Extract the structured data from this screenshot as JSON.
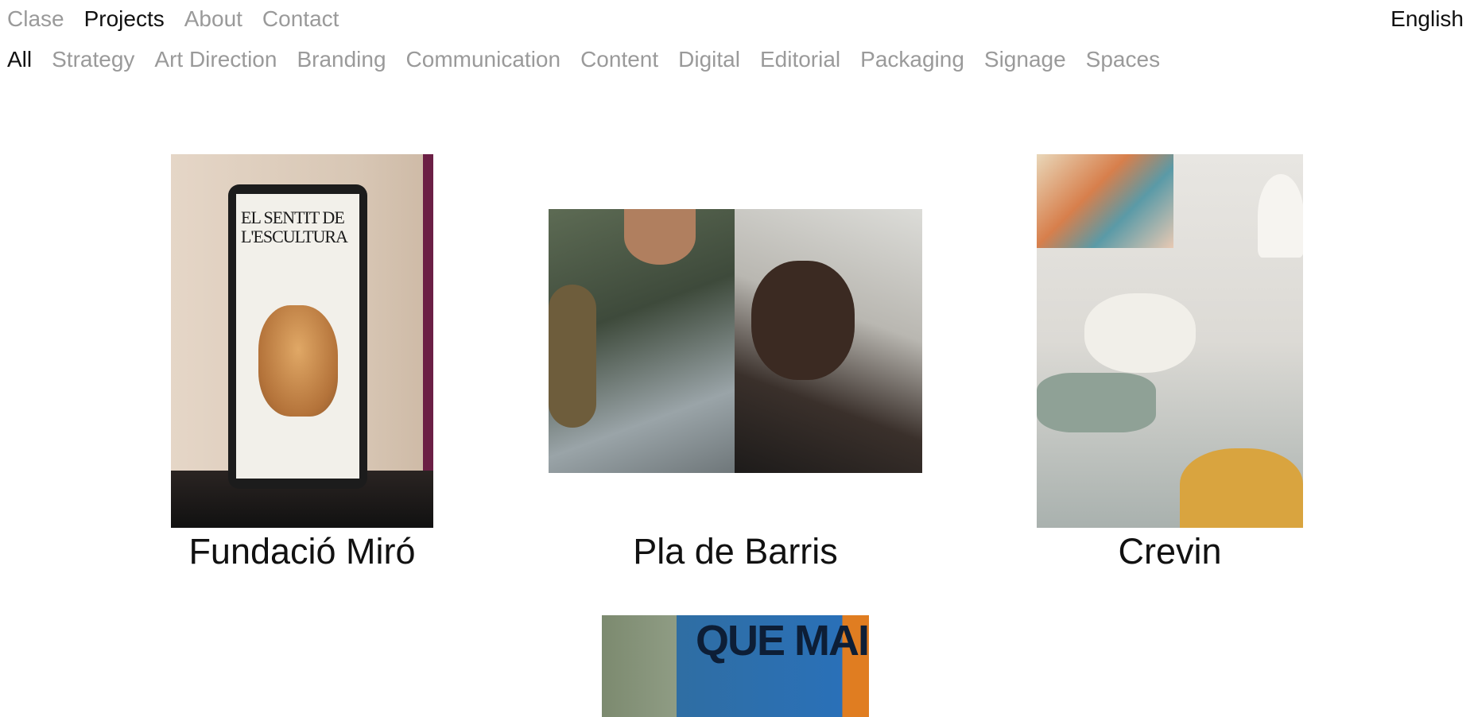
{
  "nav": {
    "items": [
      {
        "label": "Clase",
        "active": false
      },
      {
        "label": "Projects",
        "active": true
      },
      {
        "label": "About",
        "active": false
      },
      {
        "label": "Contact",
        "active": false
      }
    ],
    "language": "English"
  },
  "filters": [
    {
      "label": "All",
      "active": true
    },
    {
      "label": "Strategy",
      "active": false
    },
    {
      "label": "Art Direction",
      "active": false
    },
    {
      "label": "Branding",
      "active": false
    },
    {
      "label": "Communication",
      "active": false
    },
    {
      "label": "Content",
      "active": false
    },
    {
      "label": "Digital",
      "active": false
    },
    {
      "label": "Editorial",
      "active": false
    },
    {
      "label": "Packaging",
      "active": false
    },
    {
      "label": "Signage",
      "active": false
    },
    {
      "label": "Spaces",
      "active": false
    }
  ],
  "projects": [
    {
      "title": "Fundació Miró",
      "poster_text": "EL SENTIT DE L'ESCULTURA",
      "icon": "poster-image"
    },
    {
      "title": "Pla de Barris",
      "icon": "photo-image"
    },
    {
      "title": "Crevin",
      "icon": "interior-photo-image"
    },
    {
      "title": "",
      "icon": "house-illustration-image"
    },
    {
      "title": "",
      "poster_text": "QUE MAI",
      "icon": "street-poster-image"
    }
  ],
  "colors": {
    "text_active": "#111111",
    "text_inactive": "#9a9a9a",
    "background": "#ffffff"
  }
}
